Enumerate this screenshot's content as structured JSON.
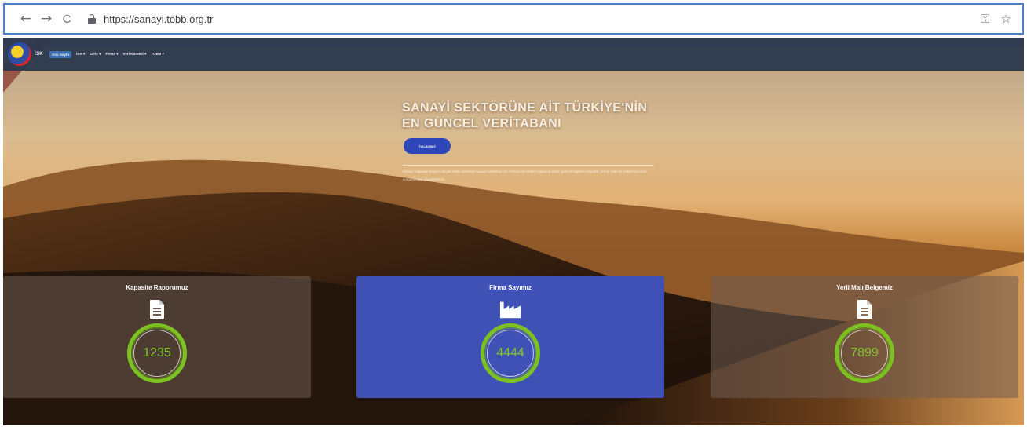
{
  "browser": {
    "url": "https://sanayi.tobb.org.tr",
    "back_icon": "←",
    "forward_icon": "→",
    "reload_icon": "C",
    "key_icon": "🔑",
    "star_icon": "☆"
  },
  "navbar": {
    "brand": "İSK",
    "items": [
      {
        "label": "Ana Sayfa",
        "active": true
      },
      {
        "label": "İSK ▾",
        "active": false
      },
      {
        "label": "Giriş ▾",
        "active": false
      },
      {
        "label": "Firma ▾",
        "active": false
      },
      {
        "label": "Veri Kümesi ▾",
        "active": false
      },
      {
        "label": "TOBB ▾",
        "active": false
      }
    ]
  },
  "hero": {
    "title_line1": "SANAYİ SEKTÖRÜNE AİT TÜRKİYE'NİN",
    "title_line2": "EN GÜNCEL VERİTABANI",
    "button": "TIKLAYINIZ",
    "description": "Sanayi Kapasite Raporu bilgilerinden derlenen sanayi veritabanı ile Türkiye'nin üretim yapısına ilişkin güncel bilgilere erişebilir, firma, ürün ve sektör bazında sorgulamalar yapabilirsiniz."
  },
  "stats": [
    {
      "title": "Kapasite Raporumuz",
      "value": "1235",
      "icon": "document-icon"
    },
    {
      "title": "Firma Sayımız",
      "value": "4444",
      "icon": "factory-icon"
    },
    {
      "title": "Yerli Malı Belgemiz",
      "value": "7899",
      "icon": "document-icon"
    }
  ],
  "colors": {
    "navbar": "#2c384e",
    "primary_card": "#3f51b5",
    "counter_ring": "#7cc11f",
    "hero_button": "#2f46b8"
  }
}
